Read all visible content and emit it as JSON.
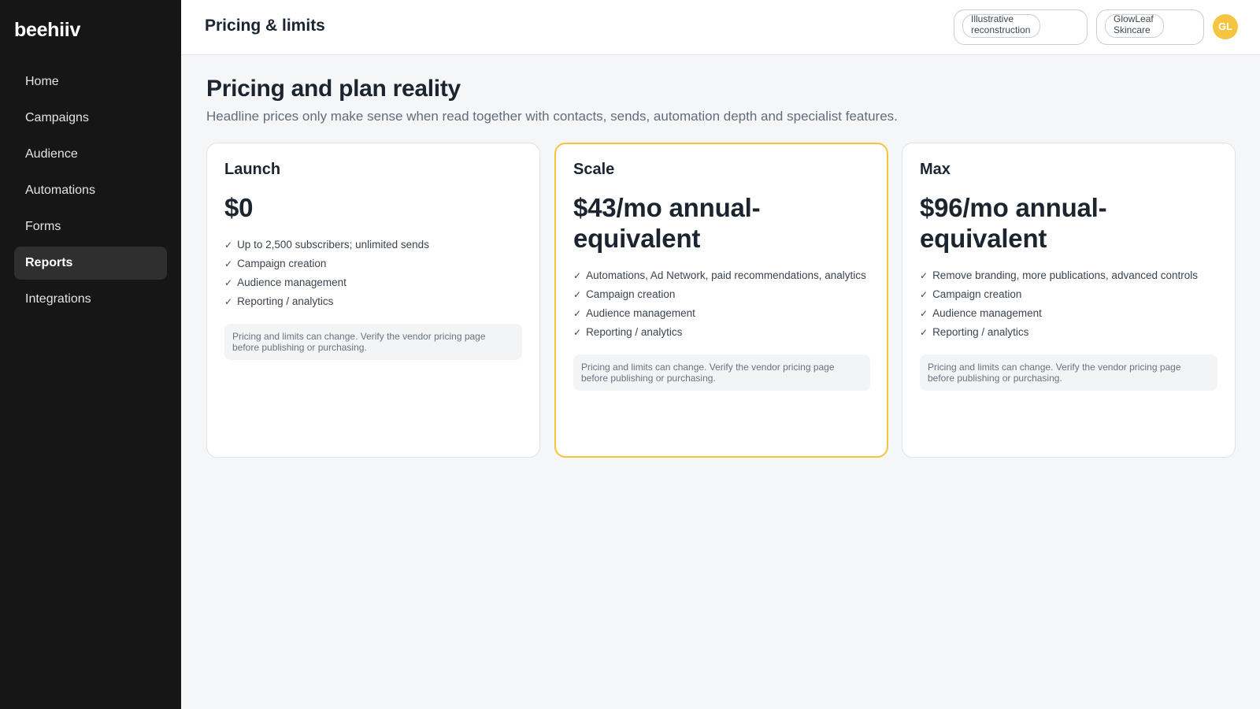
{
  "sidebar": {
    "brand": "beehiiv",
    "items": [
      {
        "label": "Home"
      },
      {
        "label": "Campaigns"
      },
      {
        "label": "Audience"
      },
      {
        "label": "Automations"
      },
      {
        "label": "Forms"
      },
      {
        "label": "Reports",
        "active": true
      },
      {
        "label": "Integrations"
      }
    ]
  },
  "header": {
    "title": "Pricing & limits",
    "pill_1": {
      "line1": "Illustrative",
      "line2": "reconstruction"
    },
    "pill_2": {
      "line1": "GlowLeaf",
      "line2": "Skincare"
    },
    "avatar_initials": "GL"
  },
  "main": {
    "title": "Pricing and plan reality",
    "subtitle": "Headline prices only make sense when read together with contacts, sends, automation depth and specialist features.",
    "plans": [
      {
        "name": "Launch",
        "price": "$0",
        "features": [
          "Up to 2,500 subscribers; unlimited sends",
          "Campaign creation",
          "Audience management",
          "Reporting / analytics"
        ],
        "note": "Pricing and limits can change. Verify the vendor pricing page before publishing or purchasing."
      },
      {
        "name": "Scale",
        "price": "$43/mo annual-equivalent",
        "featured": true,
        "features": [
          "Automations, Ad Network, paid recommendations, analytics",
          "Campaign creation",
          "Audience management",
          "Reporting / analytics"
        ],
        "note": "Pricing and limits can change. Verify the vendor pricing page before publishing or purchasing."
      },
      {
        "name": "Max",
        "price": "$96/mo annual-equivalent",
        "features": [
          "Remove branding, more publications, advanced controls",
          "Campaign creation",
          "Audience management",
          "Reporting / analytics"
        ],
        "note": "Pricing and limits can change. Verify the vendor pricing page before publishing or purchasing."
      }
    ]
  },
  "colors": {
    "sidebar_bg": "#161616",
    "accent": "#f4c53c",
    "page_bg": "#f5f6f8"
  },
  "icons": {
    "check": "check-icon"
  }
}
